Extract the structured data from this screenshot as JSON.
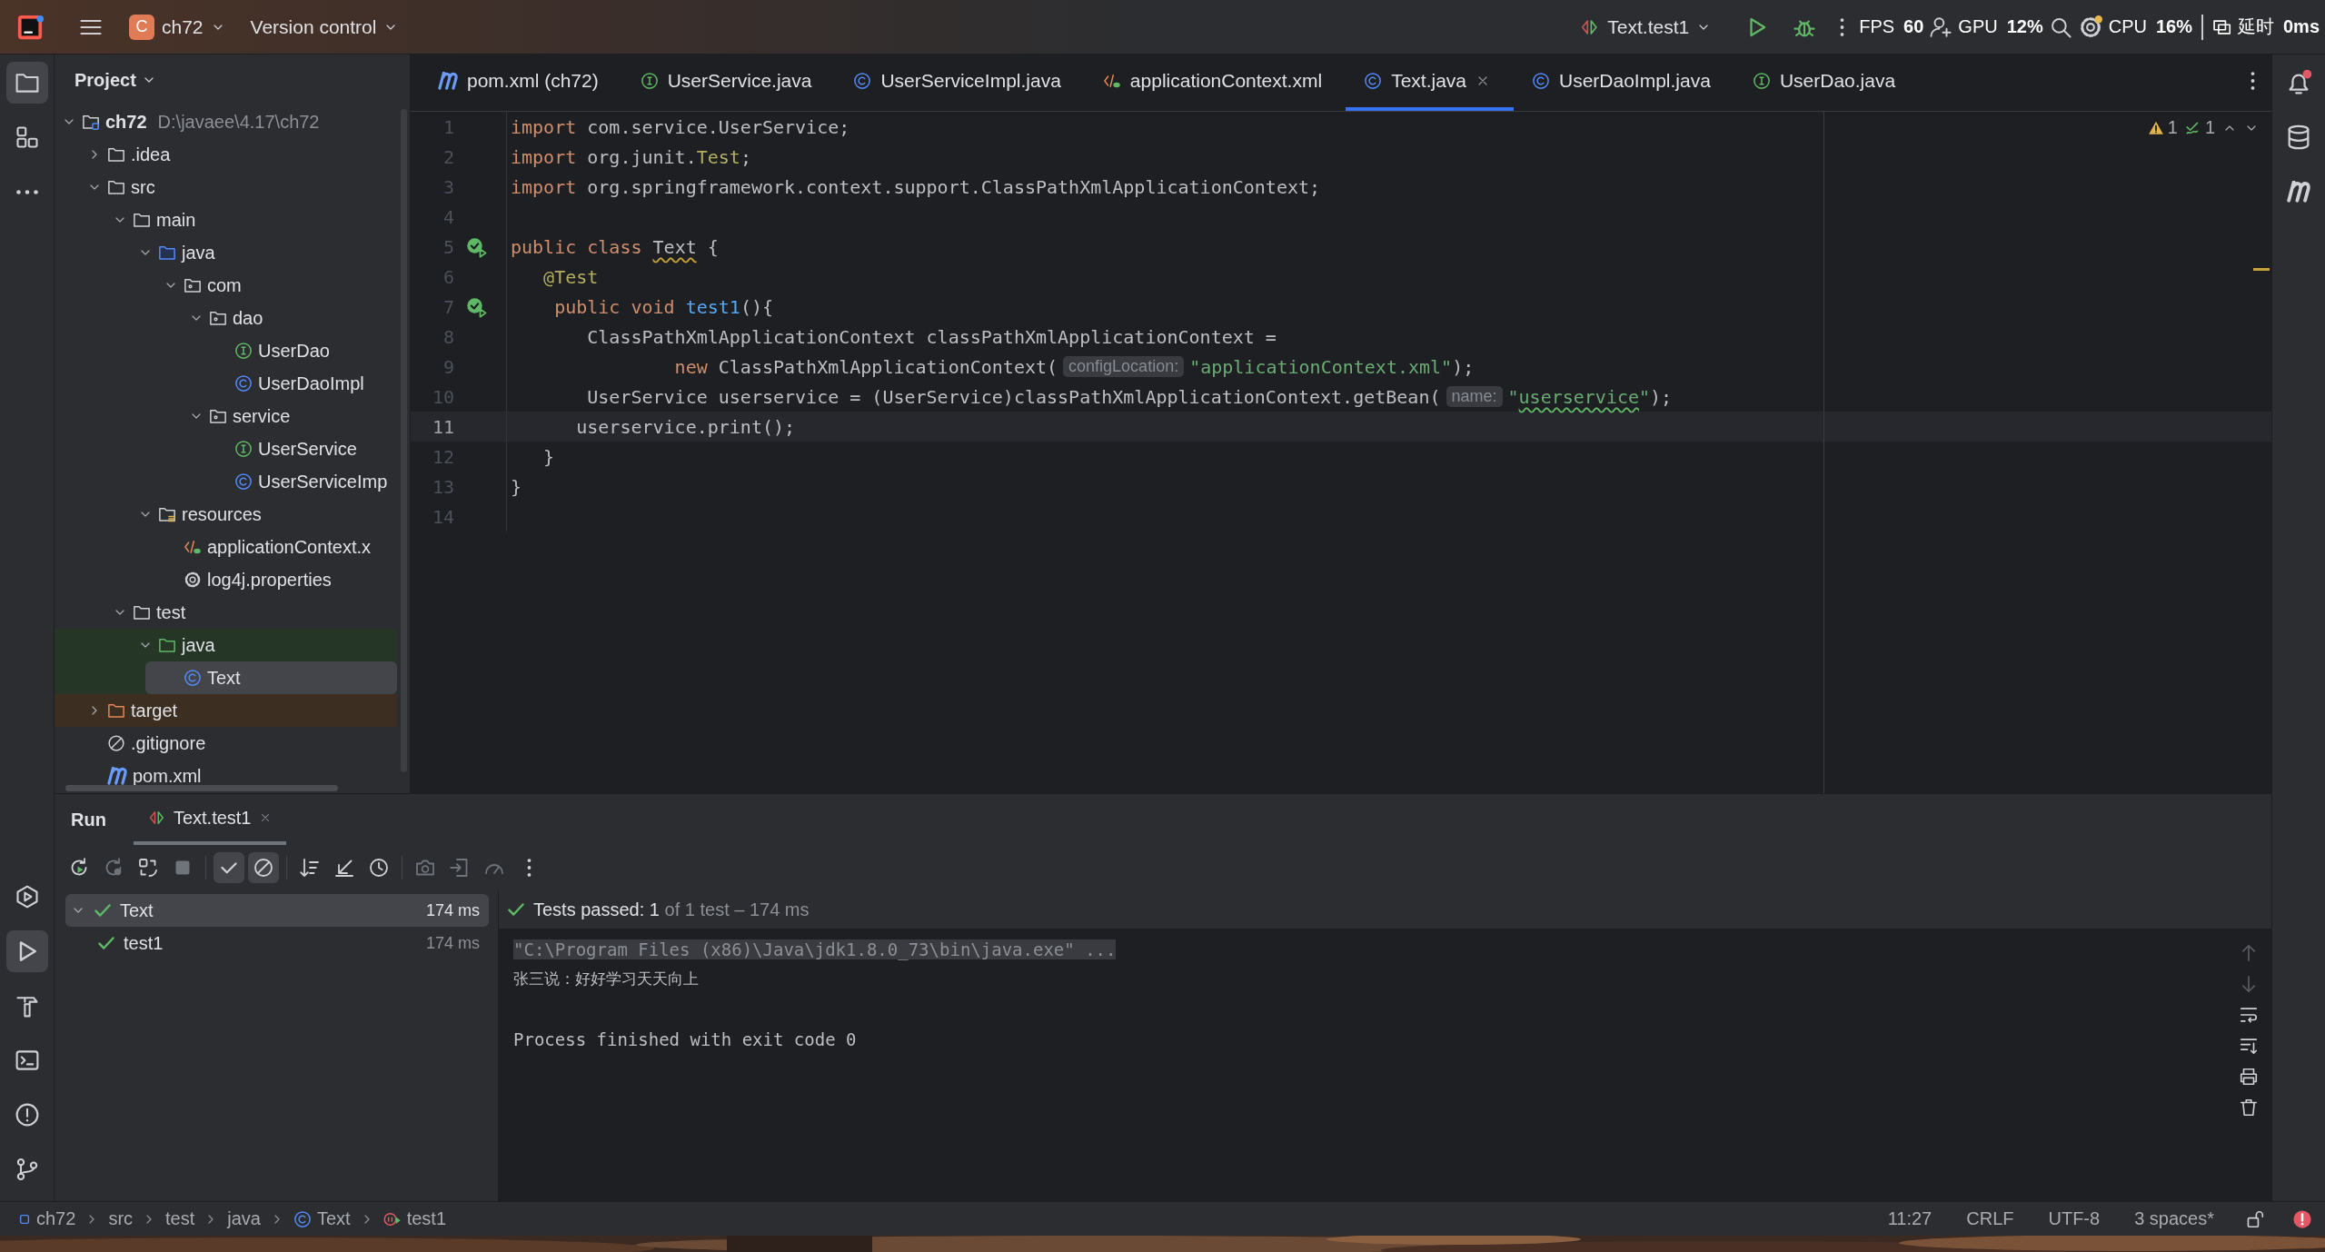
{
  "title_bar": {
    "project_badge": "C",
    "project": "ch72",
    "vcs": "Version control",
    "run_config": "Text.test1"
  },
  "perf_overlay": [
    {
      "label": "FPS",
      "value": "60"
    },
    {
      "label": "GPU",
      "value": "12%"
    },
    {
      "label": "CPU",
      "value": "16%"
    },
    {
      "label": "延时",
      "value": "0ms"
    }
  ],
  "left_toolbar": {
    "top": [
      {
        "kind": "project",
        "selected": true
      },
      {
        "kind": "structure",
        "selected": false
      },
      {
        "kind": "more",
        "selected": false
      }
    ],
    "bottom": [
      {
        "kind": "services",
        "selected": false
      },
      {
        "kind": "run",
        "selected": true
      },
      {
        "kind": "build",
        "selected": false
      },
      {
        "kind": "terminal",
        "selected": false
      },
      {
        "kind": "problems",
        "selected": false
      },
      {
        "kind": "git",
        "selected": false
      }
    ]
  },
  "right_toolbar": [
    {
      "kind": "notifications",
      "badge": true
    },
    {
      "kind": "database",
      "badge": false
    },
    {
      "kind": "maven",
      "badge": false
    }
  ],
  "project_panel": {
    "title": "Project",
    "tree": [
      {
        "name": "ch72",
        "path": "D:\\javaee\\4.17\\ch72",
        "kind": "module",
        "expanded": true,
        "selected": false,
        "children": [
          {
            "name": ".idea",
            "kind": "folder",
            "expanded": false,
            "selected": false
          },
          {
            "name": "src",
            "kind": "folder",
            "expanded": true,
            "selected": false,
            "children": [
              {
                "name": "main",
                "kind": "folder",
                "expanded": true,
                "selected": false,
                "children": [
                  {
                    "name": "java",
                    "kind": "source",
                    "expanded": true,
                    "selected": false,
                    "children": [
                      {
                        "name": "com",
                        "kind": "package",
                        "expanded": true,
                        "selected": false,
                        "children": [
                          {
                            "name": "dao",
                            "kind": "package",
                            "expanded": true,
                            "selected": false,
                            "children": [
                              {
                                "name": "UserDao",
                                "kind": "interface",
                                "selected": false
                              },
                              {
                                "name": "UserDaoImpl",
                                "kind": "class",
                                "selected": false
                              }
                            ]
                          },
                          {
                            "name": "service",
                            "kind": "package",
                            "expanded": true,
                            "selected": false,
                            "children": [
                              {
                                "name": "UserService",
                                "kind": "interface",
                                "selected": false
                              },
                              {
                                "name": "UserServiceImp",
                                "kind": "class",
                                "selected": false
                              }
                            ]
                          }
                        ]
                      }
                    ]
                  },
                  {
                    "name": "resources",
                    "kind": "resources",
                    "expanded": true,
                    "selected": false,
                    "children": [
                      {
                        "name": "applicationContext.x",
                        "kind": "xml",
                        "selected": false
                      },
                      {
                        "name": "log4j.properties",
                        "kind": "properties",
                        "selected": false
                      }
                    ]
                  }
                ]
              },
              {
                "name": "test",
                "kind": "folder",
                "expanded": true,
                "selected": false,
                "children": [
                  {
                    "name": "java",
                    "kind": "test-source",
                    "expanded": true,
                    "selected": false,
                    "children": [
                      {
                        "name": "Text",
                        "kind": "class",
                        "selected": true
                      }
                    ]
                  }
                ]
              }
            ]
          },
          {
            "name": "target",
            "kind": "excluded",
            "expanded": false,
            "selected": false
          },
          {
            "name": ".gitignore",
            "kind": "ignore",
            "selected": false
          },
          {
            "name": "pom.xml",
            "kind": "maven",
            "selected": false
          }
        ]
      }
    ]
  },
  "editor": {
    "tabs": [
      {
        "label": "pom.xml (ch72)",
        "kind": "maven",
        "selected": false
      },
      {
        "label": "UserService.java",
        "kind": "interface",
        "selected": false
      },
      {
        "label": "UserServiceImpl.java",
        "kind": "class",
        "selected": false
      },
      {
        "label": "applicationContext.xml",
        "kind": "xml",
        "selected": false
      },
      {
        "label": "Text.java",
        "kind": "class",
        "selected": true
      },
      {
        "label": "UserDaoImpl.java",
        "kind": "class",
        "selected": false
      },
      {
        "label": "UserDao.java",
        "kind": "interface",
        "selected": false
      }
    ],
    "inspections": {
      "warnings": "1",
      "checks": "1"
    },
    "lines": [
      {
        "number": "1",
        "current": false,
        "run_marker": false,
        "code": [
          {
            "text": "import",
            "kind": "keyword"
          },
          {
            "text": " com.service.UserService;",
            "kind": "plain"
          }
        ]
      },
      {
        "number": "2",
        "current": false,
        "run_marker": false,
        "code": [
          {
            "text": "import",
            "kind": "keyword"
          },
          {
            "text": " org.junit.",
            "kind": "plain"
          },
          {
            "text": "Test",
            "kind": "annotation"
          },
          {
            "text": ";",
            "kind": "plain"
          }
        ]
      },
      {
        "number": "3",
        "current": false,
        "run_marker": false,
        "code": [
          {
            "text": "import",
            "kind": "keyword"
          },
          {
            "text": " org.springframework.context.support.ClassPathXmlApplicationContext;",
            "kind": "plain"
          }
        ]
      },
      {
        "number": "4",
        "current": false,
        "run_marker": false
      },
      {
        "number": "5",
        "current": false,
        "run_marker": true,
        "code": [
          {
            "text": "public class ",
            "kind": "keyword"
          },
          {
            "text": "Text",
            "kind": "warned"
          },
          {
            "text": " {",
            "kind": "plain"
          }
        ]
      },
      {
        "number": "6",
        "current": false,
        "run_marker": false,
        "code": [
          {
            "text": "   @Test",
            "kind": "annotation"
          }
        ]
      },
      {
        "number": "7",
        "current": false,
        "run_marker": true,
        "code": [
          {
            "text": "    public void ",
            "kind": "keyword"
          },
          {
            "text": "test1",
            "kind": "method"
          },
          {
            "text": "(){",
            "kind": "plain"
          }
        ]
      },
      {
        "number": "8",
        "current": false,
        "run_marker": false,
        "code": [
          {
            "text": "       ClassPathXmlApplicationContext classPathXmlApplicationContext =",
            "kind": "plain"
          }
        ]
      },
      {
        "number": "9",
        "current": false,
        "run_marker": false,
        "code": [
          {
            "text": "               new",
            "kind": "keyword"
          },
          {
            "text": " ClassPathXmlApplicationContext(",
            "kind": "plain"
          },
          {
            "text": "configLocation:",
            "kind": "hint"
          },
          {
            "text": "\"applicationContext.xml\"",
            "kind": "string"
          },
          {
            "text": ");",
            "kind": "plain"
          }
        ]
      },
      {
        "number": "10",
        "current": false,
        "run_marker": false,
        "code": [
          {
            "text": "       UserService userservice = (UserService)classPathXmlApplicationContext.getBean(",
            "kind": "plain"
          },
          {
            "text": "name:",
            "kind": "hint"
          },
          {
            "text": "\"",
            "kind": "string"
          },
          {
            "text": "userservice",
            "kind": "string-typo"
          },
          {
            "text": "\"",
            "kind": "string"
          },
          {
            "text": ");",
            "kind": "plain"
          }
        ]
      },
      {
        "number": "11",
        "current": true,
        "run_marker": false,
        "code": [
          {
            "text": "      userservice.print();",
            "kind": "plain"
          }
        ]
      },
      {
        "number": "12",
        "current": false,
        "run_marker": false,
        "code": [
          {
            "text": "   }",
            "kind": "plain"
          }
        ]
      },
      {
        "number": "13",
        "current": false,
        "run_marker": false,
        "code": [
          {
            "text": "}",
            "kind": "plain"
          }
        ]
      },
      {
        "number": "14",
        "current": false,
        "run_marker": false
      }
    ]
  },
  "run_panel": {
    "title": "Run",
    "tabs": [
      {
        "label": "Text.test1",
        "selected": true
      }
    ],
    "toolbar": [
      {
        "kind": "rerun",
        "disabled": false,
        "on": false
      },
      {
        "kind": "rerun-failed",
        "disabled": true,
        "on": false
      },
      {
        "kind": "auto-rerun",
        "disabled": false,
        "on": false
      },
      {
        "kind": "stop",
        "disabled": true,
        "on": false
      },
      {
        "kind": "show-passed",
        "disabled": false,
        "on": true
      },
      {
        "kind": "show-ignored",
        "disabled": false,
        "on": true
      },
      {
        "kind": "sort",
        "disabled": false,
        "on": false
      },
      {
        "kind": "collapse",
        "disabled": false,
        "on": false
      },
      {
        "kind": "history",
        "disabled": false,
        "on": false
      },
      {
        "kind": "screenshot",
        "disabled": true,
        "on": false
      },
      {
        "kind": "import",
        "disabled": true,
        "on": false
      },
      {
        "kind": "gauge",
        "disabled": true,
        "on": false
      },
      {
        "kind": "more",
        "disabled": false,
        "on": false
      }
    ],
    "tests": [
      {
        "name": "Text",
        "time": "174 ms",
        "passed": true,
        "expanded": true,
        "selected": true,
        "children": [
          {
            "name": "test1",
            "time": "174 ms",
            "passed": true,
            "selected": false
          }
        ]
      }
    ],
    "summary": "Tests passed: 1",
    "summary_detail": "of 1 test – 174 ms",
    "console": [
      {
        "kind": "command",
        "text": "\"C:\\Program Files (x86)\\Java\\jdk1.8.0_73\\bin\\java.exe\" ..."
      },
      {
        "kind": "output",
        "text": "张三说：好好学习天天向上"
      },
      {
        "kind": "blank"
      },
      {
        "kind": "output",
        "text": "Process finished with exit code 0"
      }
    ]
  },
  "breadcrumbs": [
    {
      "label": "ch72",
      "kind": "module"
    },
    {
      "label": "src",
      "kind": "plain"
    },
    {
      "label": "test",
      "kind": "plain"
    },
    {
      "label": "java",
      "kind": "plain"
    },
    {
      "label": "Text",
      "kind": "class"
    },
    {
      "label": "test1",
      "kind": "test-method"
    }
  ],
  "status_bar": {
    "position": "11:27",
    "line_separator": "CRLF",
    "encoding": "UTF-8",
    "indent": "3 spaces*"
  }
}
